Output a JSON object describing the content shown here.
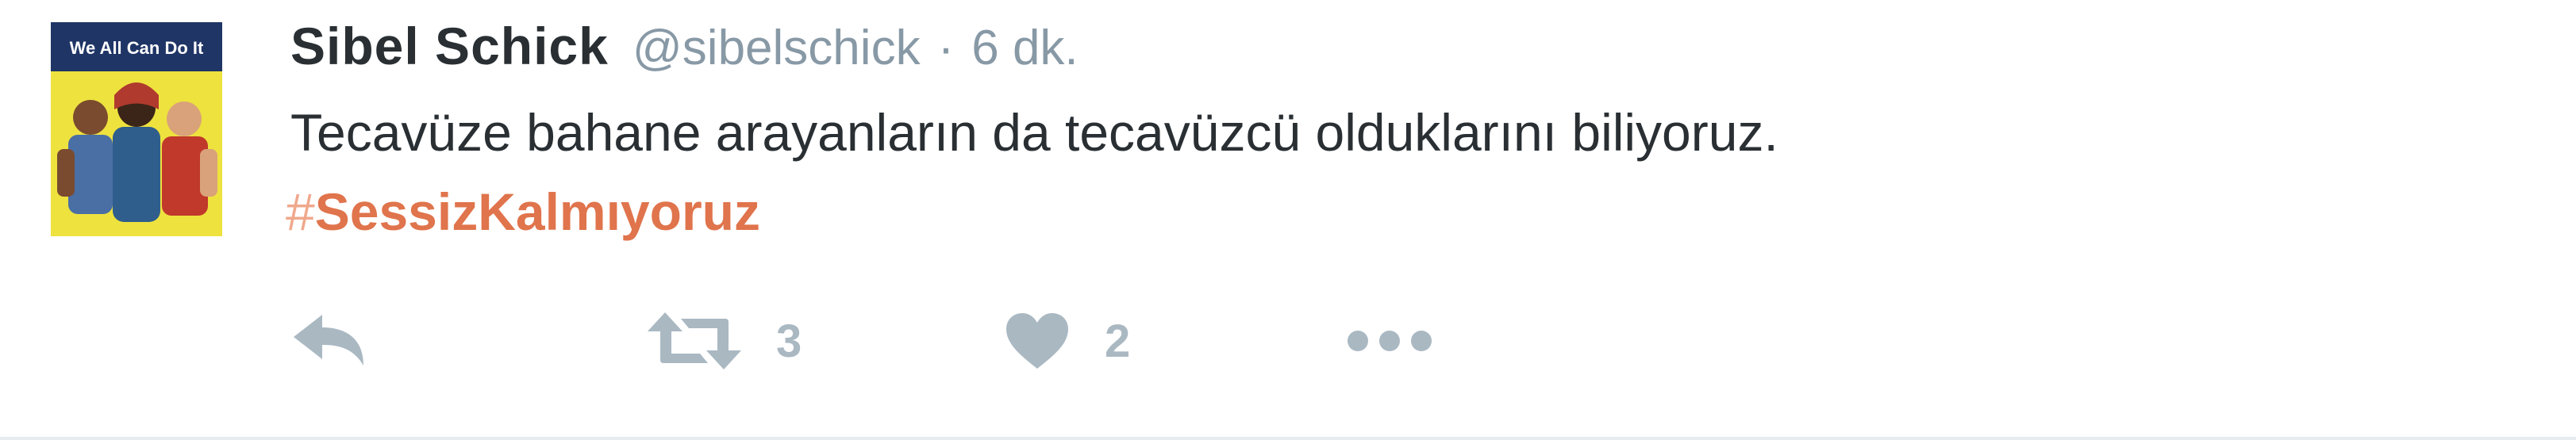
{
  "tweet": {
    "display_name": "Sibel Schick",
    "handle": "@sibelschick",
    "separator": "·",
    "time": "6 dk.",
    "text": "Tecavüze bahane arayanların da tecavüzcü olduklarını biliyoruz.",
    "hashtag_symbol": "#",
    "hashtag": "SessizKalmıyoruz",
    "avatar_text": "We All Can Do It"
  },
  "actions": {
    "reply_icon": "reply-icon",
    "retweet_icon": "retweet-icon",
    "retweet_count": "3",
    "like_icon": "heart-icon",
    "like_count": "2",
    "more_icon": "more-icon"
  },
  "colors": {
    "name": "#292f33",
    "meta": "#8899a6",
    "hashtag": "#e0744c",
    "action_icon": "#aab8c2",
    "avatar_bg": "#f0e640"
  }
}
